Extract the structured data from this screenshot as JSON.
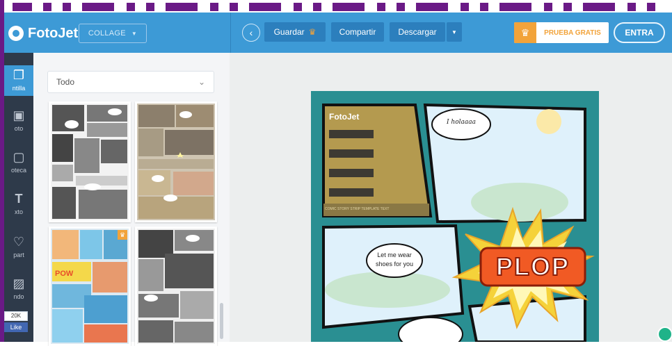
{
  "header": {
    "brand": "FotoJet",
    "mode_selector": "COLLAGE",
    "back_icon": "chevron-left-icon",
    "buttons": {
      "save": "Guardar",
      "share": "Compartir",
      "download": "Descargar"
    },
    "trial": "PRUEBA GRATIS",
    "login": "ENTRA"
  },
  "sidebar_icons": [
    {
      "label": "ntilla",
      "icon": "template-icon",
      "active": true
    },
    {
      "label": "oto",
      "icon": "photo-icon",
      "active": false
    },
    {
      "label": "oteca",
      "icon": "library-icon",
      "active": false
    },
    {
      "label": "xto",
      "icon": "text-icon",
      "active": false
    },
    {
      "label": "part",
      "icon": "clipart-icon",
      "active": false
    },
    {
      "label": "ndo",
      "icon": "background-icon",
      "active": false
    }
  ],
  "facebook": {
    "count": "20K",
    "like": "Like"
  },
  "panel": {
    "filter": "Todo",
    "filter_icon": "chevron-down-icon",
    "templates": [
      "comic-bw-1",
      "comic-color-1",
      "comic-color-2",
      "comic-bw-2"
    ],
    "pro_badge_icon": "crown-icon"
  },
  "poster": {
    "logo": "FotoJet",
    "bubble_1": "I holaaaa",
    "bubble_2": "Let me wear shoes for you",
    "burst_text": "PLOP",
    "stripe_text": "COMIC STORY STRIP TEMPLATE TEXT"
  },
  "colors": {
    "topbar": "#3d9ad6",
    "iconbar": "#2e3a4a",
    "accent": "#f2a33a",
    "poster_border": "#2a8f92"
  }
}
